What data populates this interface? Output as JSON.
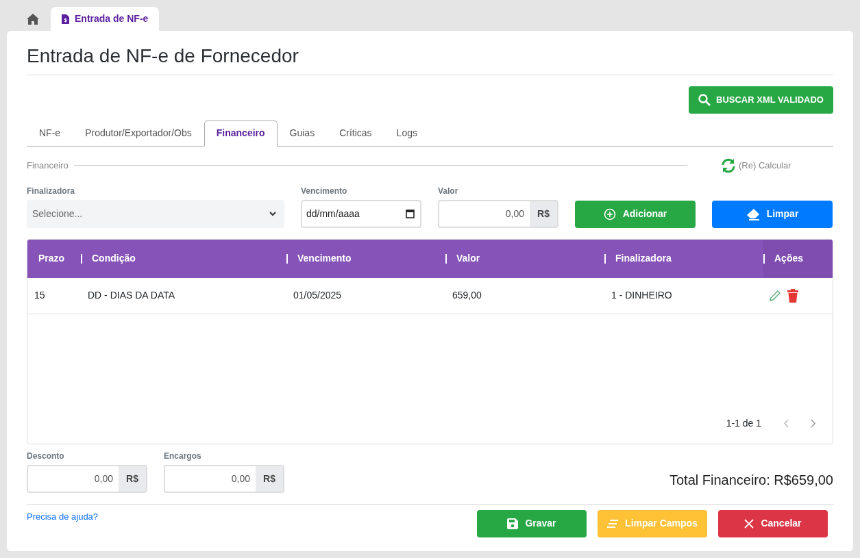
{
  "app_tabs": [
    {
      "kind": "home",
      "selected": false
    },
    {
      "kind": "document",
      "label": "Entrada de NF-e",
      "selected": true
    }
  ],
  "page_title": "Entrada de NF-e de Fornecedor",
  "search_button": "BUSCAR XML VALIDADO",
  "tabs": [
    {
      "label": "NF-e",
      "selected": false
    },
    {
      "label": "Produtor/Exportador/Obs",
      "selected": false
    },
    {
      "label": "Financeiro",
      "selected": true
    },
    {
      "label": "Guias",
      "selected": false
    },
    {
      "label": "Críticas",
      "selected": false
    },
    {
      "label": "Logs",
      "selected": false
    }
  ],
  "section": {
    "legend": "Financeiro",
    "recalc_button": "(Re) Calcular"
  },
  "form": {
    "finalizadora": {
      "label": "Finalizadora",
      "placeholder": "Selecione..."
    },
    "vencimento": {
      "label": "Vencimento",
      "placeholder": "dd/mm/aaaa"
    },
    "valor": {
      "label": "Valor",
      "value": "0,00",
      "addon": "R$"
    },
    "add_button": "Adicionar",
    "clear_button": "Limpar"
  },
  "table": {
    "columns": [
      "Prazo",
      "Condição",
      "Vencimento",
      "Valor",
      "Finalizadora",
      "Ações"
    ],
    "rows": [
      {
        "cells": [
          "15",
          "DD - DIAS DA DATA",
          "01/05/2025",
          "659,00",
          "1 - DINHEIRO"
        ]
      }
    ],
    "pagination": "1-1 de 1"
  },
  "totals": {
    "desconto": {
      "label": "Desconto",
      "value": "0,00",
      "addon": "R$"
    },
    "encargos": {
      "label": "Encargos",
      "value": "0,00",
      "addon": "R$"
    },
    "total": "Total Financeiro: R$659,00"
  },
  "help_link": "Precisa de ajuda?",
  "footer_buttons": [
    {
      "kind": "save",
      "label": "Gravar"
    },
    {
      "kind": "clear",
      "label": "Limpar Campos"
    },
    {
      "kind": "cancel",
      "label": "Cancelar"
    }
  ]
}
